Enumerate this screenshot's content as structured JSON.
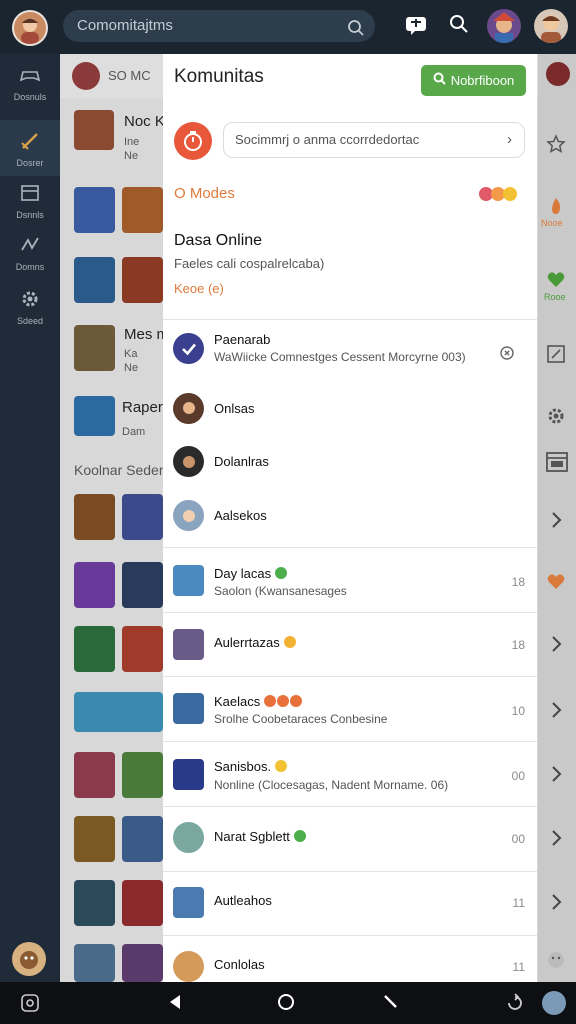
{
  "topbar": {
    "search_text": "Comomitajtms"
  },
  "left_rail": {
    "items": [
      {
        "label": "Dosnuls"
      },
      {
        "label": "Dosrer"
      },
      {
        "label": "Dsnnls"
      },
      {
        "label": "Domns"
      },
      {
        "label": "Sdeed"
      }
    ]
  },
  "background": {
    "header_text": "SO MC",
    "items": [
      {
        "title": "Noc K",
        "sub1": "Ine",
        "sub2": "Ne"
      },
      {
        "title": "Mes m",
        "sub1": "Ka",
        "sub2": "Ne"
      },
      {
        "title": "RaperK",
        "sub1": "Dam",
        "sub2": ""
      }
    ],
    "section_label": "Koolnar Seder"
  },
  "right_rail": {
    "labels": [
      "Nooe",
      "Rooe"
    ]
  },
  "panel": {
    "title": "Komunitas",
    "new_button_label": "Nobrfiboon",
    "status_placeholder": "Socimmrj o anma ccorrdedortac",
    "section_label": "O Modes",
    "online": {
      "title": "Dasa Online",
      "subtitle": "Faeles cali cospalrelcaba)",
      "link": "Keoe (e)"
    },
    "pinned": [
      {
        "name": "Paenarab",
        "sub": "WaWiicke Comnestges Cessent Morcyrne  003)"
      },
      {
        "name": "Onlsas"
      },
      {
        "name": "Dolanlras"
      },
      {
        "name": "Aalsekos"
      }
    ],
    "chats": [
      {
        "name": "Day lacas",
        "sub": "Saolon (Kwansanesages",
        "count": "18",
        "emoji_color": "#4cae4c"
      },
      {
        "name": "Aulerrtazas",
        "sub": "",
        "count": "18",
        "emoji_color": "#f2b233"
      },
      {
        "name": "Kaelacs",
        "sub": "Srolhe Coobetaraces Conbesine",
        "count": "10",
        "emoji_color": "#e8703a"
      },
      {
        "name": "Sanisbos.",
        "sub": "Nonline (Clocesagas, Nadent Morname. 06)",
        "count": "00",
        "emoji_color": "#f2c233"
      },
      {
        "name": "Narat Sgblett",
        "sub": "",
        "count": "00",
        "emoji_color": "#4cae4c"
      },
      {
        "name": "Autleahos",
        "sub": "",
        "count": "11",
        "emoji_color": ""
      },
      {
        "name": "Conlolas",
        "sub": "",
        "count": "11",
        "emoji_color": ""
      }
    ]
  },
  "colors": {
    "accent_orange": "#e07a3c",
    "green_button": "#58a84a",
    "check_blue": "#3a3f8f"
  }
}
